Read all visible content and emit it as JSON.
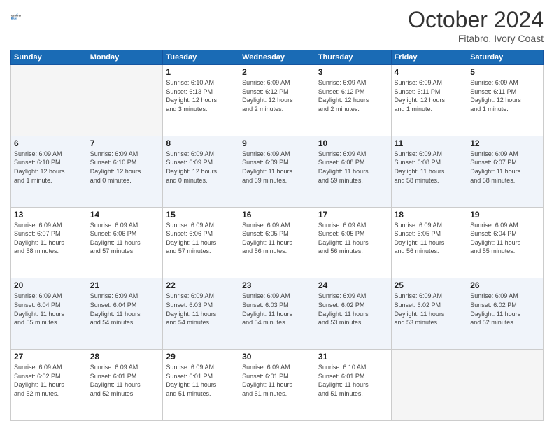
{
  "header": {
    "logo_general": "General",
    "logo_blue": "Blue",
    "month": "October 2024",
    "location": "Fitabro, Ivory Coast"
  },
  "days_of_week": [
    "Sunday",
    "Monday",
    "Tuesday",
    "Wednesday",
    "Thursday",
    "Friday",
    "Saturday"
  ],
  "weeks": [
    [
      {
        "day": "",
        "info": ""
      },
      {
        "day": "",
        "info": ""
      },
      {
        "day": "1",
        "info": "Sunrise: 6:10 AM\nSunset: 6:13 PM\nDaylight: 12 hours\nand 3 minutes."
      },
      {
        "day": "2",
        "info": "Sunrise: 6:09 AM\nSunset: 6:12 PM\nDaylight: 12 hours\nand 2 minutes."
      },
      {
        "day": "3",
        "info": "Sunrise: 6:09 AM\nSunset: 6:12 PM\nDaylight: 12 hours\nand 2 minutes."
      },
      {
        "day": "4",
        "info": "Sunrise: 6:09 AM\nSunset: 6:11 PM\nDaylight: 12 hours\nand 1 minute."
      },
      {
        "day": "5",
        "info": "Sunrise: 6:09 AM\nSunset: 6:11 PM\nDaylight: 12 hours\nand 1 minute."
      }
    ],
    [
      {
        "day": "6",
        "info": "Sunrise: 6:09 AM\nSunset: 6:10 PM\nDaylight: 12 hours\nand 1 minute."
      },
      {
        "day": "7",
        "info": "Sunrise: 6:09 AM\nSunset: 6:10 PM\nDaylight: 12 hours\nand 0 minutes."
      },
      {
        "day": "8",
        "info": "Sunrise: 6:09 AM\nSunset: 6:09 PM\nDaylight: 12 hours\nand 0 minutes."
      },
      {
        "day": "9",
        "info": "Sunrise: 6:09 AM\nSunset: 6:09 PM\nDaylight: 11 hours\nand 59 minutes."
      },
      {
        "day": "10",
        "info": "Sunrise: 6:09 AM\nSunset: 6:08 PM\nDaylight: 11 hours\nand 59 minutes."
      },
      {
        "day": "11",
        "info": "Sunrise: 6:09 AM\nSunset: 6:08 PM\nDaylight: 11 hours\nand 58 minutes."
      },
      {
        "day": "12",
        "info": "Sunrise: 6:09 AM\nSunset: 6:07 PM\nDaylight: 11 hours\nand 58 minutes."
      }
    ],
    [
      {
        "day": "13",
        "info": "Sunrise: 6:09 AM\nSunset: 6:07 PM\nDaylight: 11 hours\nand 58 minutes."
      },
      {
        "day": "14",
        "info": "Sunrise: 6:09 AM\nSunset: 6:06 PM\nDaylight: 11 hours\nand 57 minutes."
      },
      {
        "day": "15",
        "info": "Sunrise: 6:09 AM\nSunset: 6:06 PM\nDaylight: 11 hours\nand 57 minutes."
      },
      {
        "day": "16",
        "info": "Sunrise: 6:09 AM\nSunset: 6:05 PM\nDaylight: 11 hours\nand 56 minutes."
      },
      {
        "day": "17",
        "info": "Sunrise: 6:09 AM\nSunset: 6:05 PM\nDaylight: 11 hours\nand 56 minutes."
      },
      {
        "day": "18",
        "info": "Sunrise: 6:09 AM\nSunset: 6:05 PM\nDaylight: 11 hours\nand 56 minutes."
      },
      {
        "day": "19",
        "info": "Sunrise: 6:09 AM\nSunset: 6:04 PM\nDaylight: 11 hours\nand 55 minutes."
      }
    ],
    [
      {
        "day": "20",
        "info": "Sunrise: 6:09 AM\nSunset: 6:04 PM\nDaylight: 11 hours\nand 55 minutes."
      },
      {
        "day": "21",
        "info": "Sunrise: 6:09 AM\nSunset: 6:04 PM\nDaylight: 11 hours\nand 54 minutes."
      },
      {
        "day": "22",
        "info": "Sunrise: 6:09 AM\nSunset: 6:03 PM\nDaylight: 11 hours\nand 54 minutes."
      },
      {
        "day": "23",
        "info": "Sunrise: 6:09 AM\nSunset: 6:03 PM\nDaylight: 11 hours\nand 54 minutes."
      },
      {
        "day": "24",
        "info": "Sunrise: 6:09 AM\nSunset: 6:02 PM\nDaylight: 11 hours\nand 53 minutes."
      },
      {
        "day": "25",
        "info": "Sunrise: 6:09 AM\nSunset: 6:02 PM\nDaylight: 11 hours\nand 53 minutes."
      },
      {
        "day": "26",
        "info": "Sunrise: 6:09 AM\nSunset: 6:02 PM\nDaylight: 11 hours\nand 52 minutes."
      }
    ],
    [
      {
        "day": "27",
        "info": "Sunrise: 6:09 AM\nSunset: 6:02 PM\nDaylight: 11 hours\nand 52 minutes."
      },
      {
        "day": "28",
        "info": "Sunrise: 6:09 AM\nSunset: 6:01 PM\nDaylight: 11 hours\nand 52 minutes."
      },
      {
        "day": "29",
        "info": "Sunrise: 6:09 AM\nSunset: 6:01 PM\nDaylight: 11 hours\nand 51 minutes."
      },
      {
        "day": "30",
        "info": "Sunrise: 6:09 AM\nSunset: 6:01 PM\nDaylight: 11 hours\nand 51 minutes."
      },
      {
        "day": "31",
        "info": "Sunrise: 6:10 AM\nSunset: 6:01 PM\nDaylight: 11 hours\nand 51 minutes."
      },
      {
        "day": "",
        "info": ""
      },
      {
        "day": "",
        "info": ""
      }
    ]
  ]
}
